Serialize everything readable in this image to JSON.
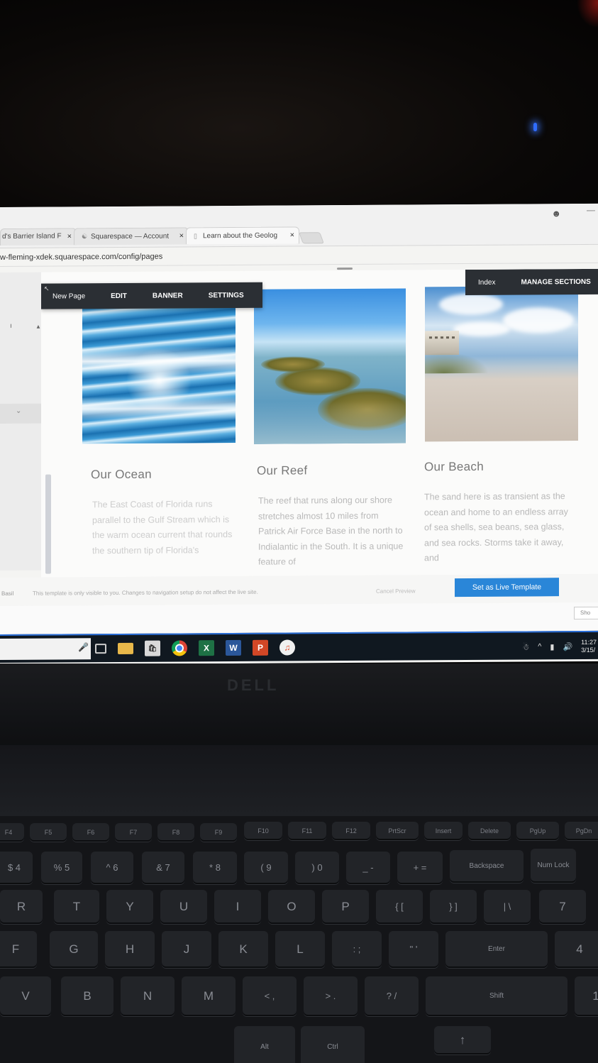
{
  "browser": {
    "tabs": [
      {
        "label": "d's Barrier Island F",
        "close": "×"
      },
      {
        "label": "Squarespace — Account",
        "close": "×"
      },
      {
        "label": "Learn about the Geolog",
        "close": "×"
      }
    ],
    "url": "w-fleming-xdek.squarespace.com/config/pages"
  },
  "editor": {
    "toolbar": {
      "new_page": "New Page",
      "edit": "EDIT",
      "banner": "BANNER",
      "settings": "SETTINGS"
    },
    "index_bar": {
      "index": "Index",
      "manage_sections": "MANAGE SECTIONS"
    }
  },
  "columns": [
    {
      "title": "Our Ocean",
      "text": "The East Coast of Florida runs parallel to the Gulf Stream which is the warm ocean current that rounds the southern tip of Florida's"
    },
    {
      "title": "Our Reef",
      "text": "The reef that runs along our shore stretches almost 10 miles from Patrick Air Force Base in the north to Indialantic in the South. It is a unique feature of"
    },
    {
      "title": "Our Beach",
      "text": "The sand here is as transient as the ocean and home to an endless array of sea shells, sea beans, sea glass, and sea rocks. Storms take it away, and"
    }
  ],
  "footer": {
    "template_name": "Basil",
    "notice": "This template is only visible to you. Changes to navigation setup do not affect the live site.",
    "cancel_preview": "Cancel Preview",
    "set_live": "Set as Live Template",
    "show": "Sho"
  },
  "taskbar": {
    "time": "11:27",
    "date": "3/15/"
  },
  "keyboard": {
    "fn_row": [
      "F4",
      "F5",
      "F6",
      "F7",
      "F8",
      "F9",
      "F10",
      "F11",
      "F12",
      "PrtScr",
      "Insert",
      "Delete",
      "PgUp",
      "PgDn"
    ],
    "num_row": [
      "$ 4",
      "% 5",
      "^ 6",
      "& 7",
      "* 8",
      "( 9",
      ") 0",
      "_ -",
      "+ =",
      "Backspace",
      "Num Lock"
    ],
    "row_q": [
      "R",
      "T",
      "Y",
      "U",
      "I",
      "O",
      "P",
      "{ [",
      "} ]",
      "| \\",
      "7"
    ],
    "row_a": [
      "F",
      "G",
      "H",
      "J",
      "K",
      "L",
      ": ;",
      "\" '",
      "Enter",
      "4"
    ],
    "row_z": [
      "V",
      "B",
      "N",
      "M",
      "< ,",
      "> .",
      "? /",
      "Shift",
      "1"
    ],
    "row_bottom": [
      "Alt",
      "Ctrl"
    ]
  },
  "colors": {
    "editor_bar": "#2b2f34",
    "live_button": "#2a86d8",
    "taskbar": "#101820"
  }
}
